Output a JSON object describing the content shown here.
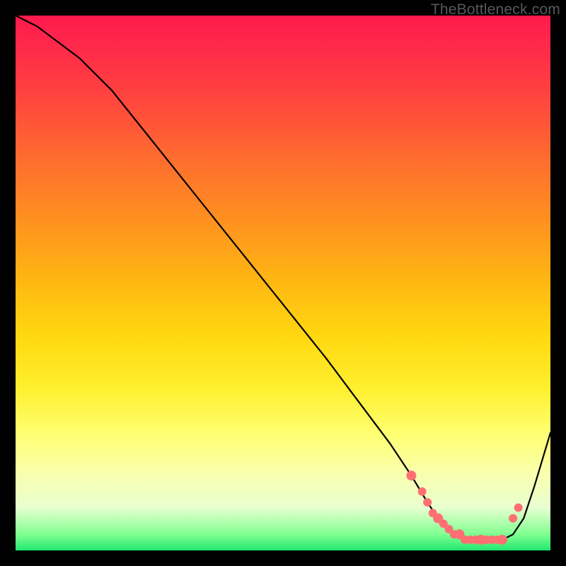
{
  "watermark": {
    "text": "TheBottleneck.com"
  },
  "colors": {
    "line": "#000000",
    "dot": "#ff6f73",
    "background_top": "#ff1a4d",
    "background_bottom": "#20e870"
  },
  "chart_data": {
    "type": "line",
    "title": "",
    "xlabel": "",
    "ylabel": "",
    "xlim": [
      0,
      100
    ],
    "ylim": [
      0,
      100
    ],
    "x": [
      0,
      4,
      8,
      12,
      18,
      26,
      34,
      42,
      50,
      58,
      64,
      70,
      74,
      77,
      79,
      81,
      83,
      85,
      87,
      89,
      91,
      93,
      95,
      97,
      100
    ],
    "values": [
      100,
      98,
      95,
      92,
      86,
      76,
      66,
      56,
      46,
      36,
      28,
      20,
      14,
      9,
      6,
      4,
      3,
      2,
      2,
      2,
      2,
      3,
      6,
      12,
      22
    ],
    "dots_x": [
      74,
      76,
      77,
      78,
      79,
      80,
      81,
      82,
      83,
      84,
      85,
      86,
      87,
      88,
      89,
      90,
      91,
      93,
      94
    ],
    "dots_y": [
      14,
      11,
      9,
      7,
      6,
      5,
      4,
      3,
      3,
      2,
      2,
      2,
      2,
      2,
      2,
      2,
      2,
      6,
      8
    ]
  }
}
